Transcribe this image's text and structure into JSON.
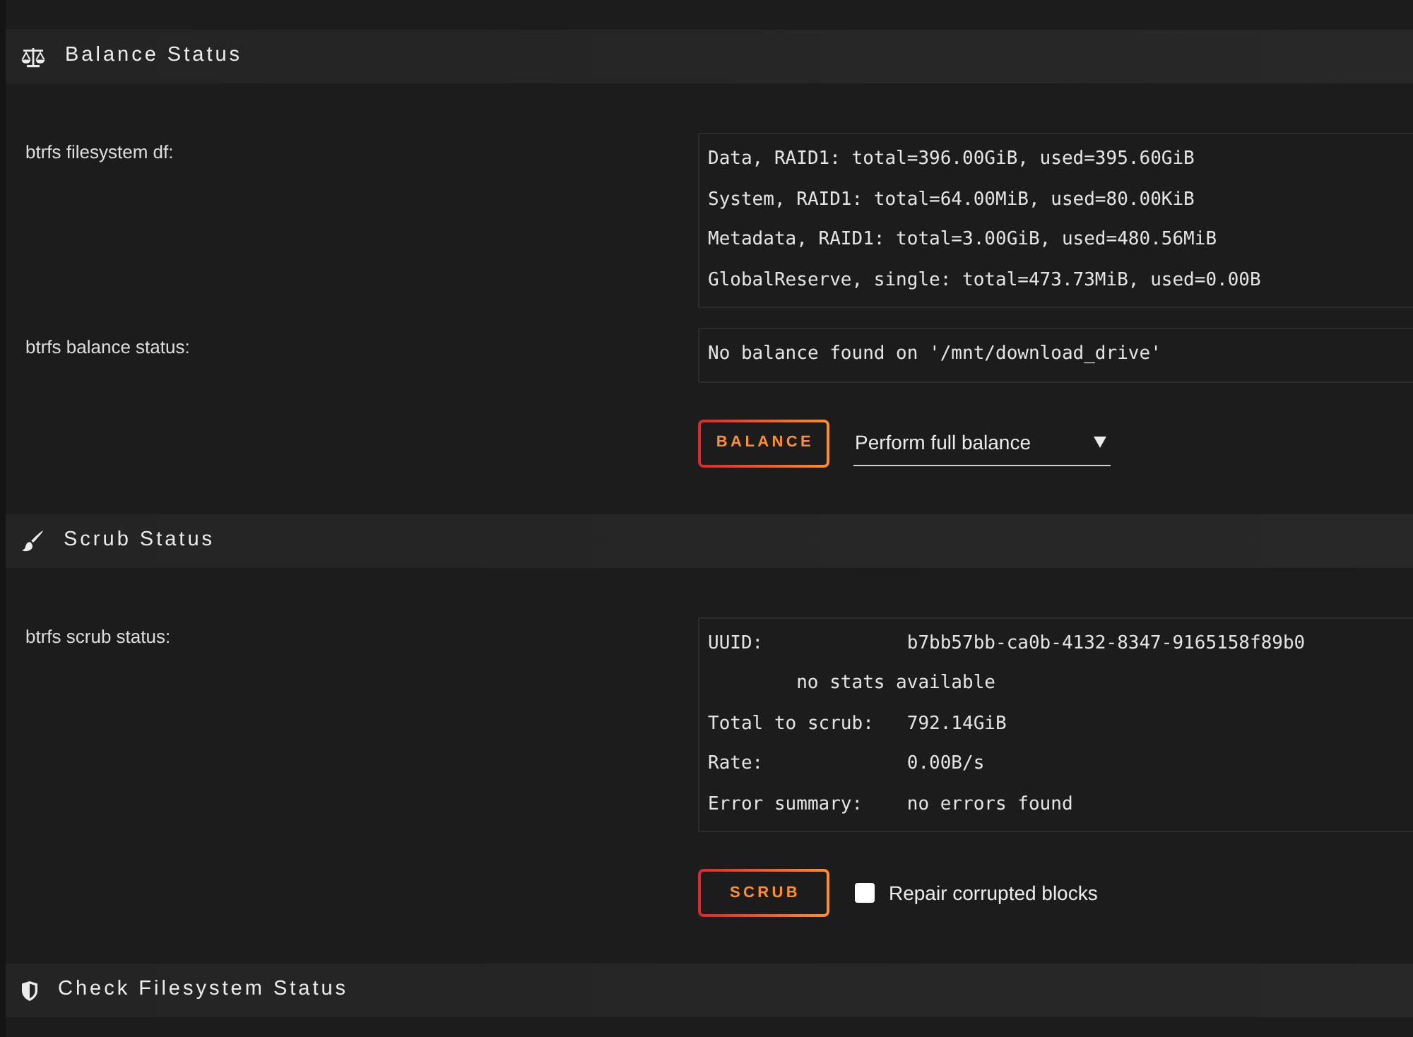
{
  "balance_section": {
    "title": "Balance Status",
    "rows": [
      {
        "label": "btrfs filesystem df:",
        "lines": [
          "Data, RAID1: total=396.00GiB, used=395.60GiB",
          "System, RAID1: total=64.00MiB, used=80.00KiB",
          "Metadata, RAID1: total=3.00GiB, used=480.56MiB",
          "GlobalReserve, single: total=473.73MiB, used=0.00B"
        ]
      },
      {
        "label": "btrfs balance status:",
        "lines": [
          "No balance found on '/mnt/download_drive'"
        ]
      }
    ],
    "button": "BALANCE",
    "mode_select": {
      "value": "Perform full balance"
    }
  },
  "scrub_section": {
    "title": "Scrub Status",
    "rows": [
      {
        "label": "btrfs scrub status:",
        "lines": [
          {
            "kind": "field",
            "label": "UUID:",
            "value": "b7bb57bb-ca0b-4132-8347-9165158f89b0"
          },
          {
            "kind": "note",
            "text": "no stats available"
          },
          {
            "kind": "field",
            "label": "Total to scrub:",
            "value": "792.14GiB"
          },
          {
            "kind": "field",
            "label": "Rate:",
            "value": "0.00B/s"
          },
          {
            "kind": "field",
            "label": "Error summary:",
            "value": "no errors found"
          }
        ]
      }
    ],
    "button": "SCRUB",
    "repair_option": {
      "label": "Repair corrupted blocks",
      "checked": false
    }
  },
  "check_section": {
    "title": "Check Filesystem Status"
  }
}
